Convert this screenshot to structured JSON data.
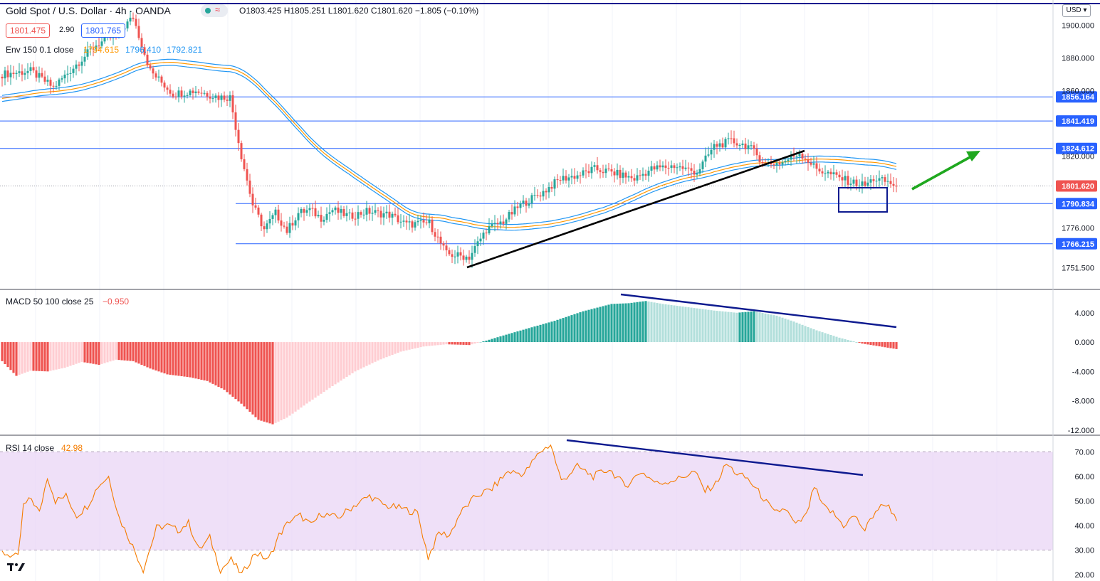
{
  "header": {
    "symbol": "Gold Spot / U.S. Dollar · 4h · OANDA",
    "ohlc": "O1803.425  H1805.251  L1801.620  C1801.620  −1.805 (−0.10%)",
    "bid": "1801.475",
    "spread": "2.90",
    "ask": "1801.765",
    "currency": "USD",
    "env_label": "Env 150 0.1 close",
    "env_values": [
      "1794.615",
      "1796.410",
      "1792.821"
    ]
  },
  "colors": {
    "up": "#26a69a",
    "down": "#ef5350",
    "hist_up_strong": "#26a69a",
    "hist_up_weak": "#b2dfdb",
    "hist_down_strong": "#ef5350",
    "hist_down_weak": "#ffcdd2",
    "level": "#2962ff",
    "env_upper": "#2196f3",
    "env_mid": "#ff9800",
    "rsi_line": "#f57c00",
    "rsi_band": "#e1bee7",
    "trend": "#000000",
    "divergence": "#0d1a8f",
    "arrow": "#1fa81f"
  },
  "chart_data": [
    {
      "type": "candlestick",
      "title": "Gold Spot / U.S. Dollar · 4h · OANDA",
      "ylim": [
        1740,
        1912
      ],
      "yticks": [
        "1900.000",
        "1880.000",
        "1860.000",
        "1820.000",
        "1776.000",
        "1751.500"
      ],
      "ytick_values": [
        1900,
        1880,
        1860,
        1820,
        1776,
        1751.5
      ],
      "levels": [
        {
          "label": "1856.164",
          "value": 1856.164
        },
        {
          "label": "1841.419",
          "value": 1841.419
        },
        {
          "label": "1824.612",
          "value": 1824.612
        },
        {
          "label": "1790.834",
          "value": 1790.834
        },
        {
          "label": "1766.215",
          "value": 1766.215
        }
      ],
      "current_price": {
        "label": "1801.620",
        "value": 1801.62
      },
      "anchors": [
        [
          0,
          1870
        ],
        [
          10,
          1872
        ],
        [
          18,
          1862
        ],
        [
          26,
          1876
        ],
        [
          33,
          1888
        ],
        [
          40,
          1894
        ],
        [
          46,
          1905
        ],
        [
          52,
          1872
        ],
        [
          60,
          1858
        ],
        [
          68,
          1860
        ],
        [
          76,
          1856
        ],
        [
          80,
          1856
        ],
        [
          84,
          1820
        ],
        [
          88,
          1790
        ],
        [
          92,
          1775
        ],
        [
          96,
          1785
        ],
        [
          100,
          1774
        ],
        [
          104,
          1785
        ],
        [
          108,
          1787
        ],
        [
          112,
          1782
        ],
        [
          116,
          1787
        ],
        [
          122,
          1783
        ],
        [
          128,
          1786
        ],
        [
          136,
          1784
        ],
        [
          142,
          1778
        ],
        [
          150,
          1779
        ],
        [
          156,
          1760
        ],
        [
          164,
          1758
        ],
        [
          170,
          1775
        ],
        [
          176,
          1780
        ],
        [
          182,
          1790
        ],
        [
          190,
          1798
        ],
        [
          196,
          1806
        ],
        [
          202,
          1808
        ],
        [
          208,
          1812
        ],
        [
          214,
          1810
        ],
        [
          222,
          1806
        ],
        [
          228,
          1812
        ],
        [
          236,
          1814
        ],
        [
          244,
          1810
        ],
        [
          250,
          1826
        ],
        [
          256,
          1829
        ],
        [
          262,
          1826
        ],
        [
          268,
          1815
        ],
        [
          274,
          1816
        ],
        [
          280,
          1822
        ],
        [
          286,
          1812
        ],
        [
          292,
          1808
        ],
        [
          298,
          1804
        ],
        [
          303,
          1802
        ],
        [
          306,
          1806
        ],
        [
          311,
          1804
        ],
        [
          314,
          1801.62
        ]
      ]
    },
    {
      "type": "bar",
      "title": "MACD 50 100 close 25",
      "value_label": "−0.950",
      "ylim": [
        -12.5,
        6.5
      ],
      "yticks": [
        "4.000",
        "0.000",
        "-4.000",
        "-8.000",
        "-12.000"
      ],
      "ytick_values": [
        4,
        0,
        -4,
        -8,
        -12
      ],
      "anchors": [
        [
          0,
          -2.6
        ],
        [
          5,
          -4.6
        ],
        [
          10,
          -3.9
        ],
        [
          16,
          -4.0
        ],
        [
          22,
          -3.5
        ],
        [
          28,
          -2.7
        ],
        [
          34,
          -3.1
        ],
        [
          40,
          -2.4
        ],
        [
          46,
          -2.6
        ],
        [
          52,
          -3.6
        ],
        [
          58,
          -4.4
        ],
        [
          66,
          -4.8
        ],
        [
          72,
          -5.3
        ],
        [
          78,
          -6.5
        ],
        [
          84,
          -8.4
        ],
        [
          90,
          -10.6
        ],
        [
          95,
          -11.2
        ],
        [
          100,
          -10.3
        ],
        [
          108,
          -8.1
        ],
        [
          116,
          -6.0
        ],
        [
          124,
          -4.0
        ],
        [
          132,
          -2.5
        ],
        [
          140,
          -1.3
        ],
        [
          148,
          -0.6
        ],
        [
          156,
          -0.3
        ],
        [
          164,
          -0.4
        ],
        [
          170,
          0.2
        ],
        [
          176,
          0.9
        ],
        [
          184,
          1.8
        ],
        [
          194,
          2.9
        ],
        [
          204,
          4.2
        ],
        [
          214,
          5.2
        ],
        [
          220,
          5.3
        ],
        [
          226,
          5.6
        ],
        [
          232,
          5.2
        ],
        [
          240,
          4.8
        ],
        [
          250,
          4.3
        ],
        [
          258,
          4.0
        ],
        [
          264,
          4.2
        ],
        [
          272,
          3.6
        ],
        [
          278,
          2.8
        ],
        [
          286,
          1.6
        ],
        [
          294,
          0.6
        ],
        [
          298,
          0.2
        ],
        [
          302,
          -0.2
        ],
        [
          314,
          -0.95
        ]
      ]
    },
    {
      "type": "line",
      "title": "RSI 14 close",
      "value_label": "42.98",
      "ylim": [
        18,
        75
      ],
      "band": [
        30,
        70
      ],
      "yticks": [
        "70.00",
        "60.00",
        "50.00",
        "40.00",
        "30.00",
        "20.00"
      ],
      "ytick_values": [
        70,
        60,
        50,
        40,
        30,
        20
      ],
      "anchors": [
        [
          0,
          29
        ],
        [
          6,
          27
        ],
        [
          8,
          48
        ],
        [
          11,
          51
        ],
        [
          14,
          45
        ],
        [
          17,
          60
        ],
        [
          20,
          50
        ],
        [
          24,
          52
        ],
        [
          28,
          44
        ],
        [
          32,
          48
        ],
        [
          36,
          56
        ],
        [
          40,
          60
        ],
        [
          44,
          43
        ],
        [
          48,
          34
        ],
        [
          53,
          22
        ],
        [
          58,
          39
        ],
        [
          62,
          40
        ],
        [
          66,
          38
        ],
        [
          70,
          41
        ],
        [
          74,
          30
        ],
        [
          78,
          35
        ],
        [
          82,
          22
        ],
        [
          86,
          26
        ],
        [
          90,
          20
        ],
        [
          95,
          29
        ],
        [
          100,
          26
        ],
        [
          104,
          36
        ],
        [
          108,
          42
        ],
        [
          112,
          44
        ],
        [
          116,
          40
        ],
        [
          120,
          45
        ],
        [
          126,
          43
        ],
        [
          132,
          48
        ],
        [
          138,
          52
        ],
        [
          144,
          48
        ],
        [
          150,
          47
        ],
        [
          156,
          45
        ],
        [
          160,
          27
        ],
        [
          164,
          37
        ],
        [
          168,
          36
        ],
        [
          172,
          45
        ],
        [
          178,
          52
        ],
        [
          184,
          55
        ],
        [
          190,
          62
        ],
        [
          196,
          61
        ],
        [
          202,
          70
        ],
        [
          206,
          73
        ],
        [
          210,
          58
        ],
        [
          216,
          64
        ],
        [
          222,
          60
        ],
        [
          228,
          63
        ],
        [
          234,
          56
        ],
        [
          240,
          62
        ],
        [
          246,
          57
        ],
        [
          254,
          59
        ],
        [
          260,
          62
        ],
        [
          264,
          54
        ],
        [
          268,
          57
        ],
        [
          272,
          65
        ],
        [
          276,
          61
        ],
        [
          280,
          59
        ],
        [
          286,
          51
        ],
        [
          290,
          45
        ],
        [
          294,
          47
        ],
        [
          298,
          40
        ],
        [
          302,
          44
        ],
        [
          305,
          56
        ],
        [
          308,
          48
        ],
        [
          312,
          45
        ],
        [
          316,
          40
        ],
        [
          320,
          44
        ],
        [
          324,
          38
        ],
        [
          328,
          46
        ],
        [
          332,
          49
        ],
        [
          336,
          43
        ]
      ]
    }
  ]
}
